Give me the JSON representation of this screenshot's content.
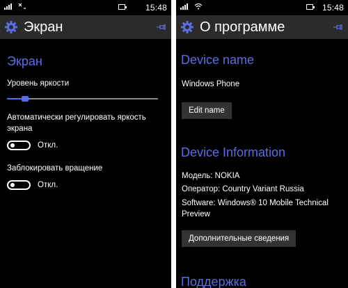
{
  "left_screen": {
    "status": {
      "time": "15:48"
    },
    "title": "Экран",
    "section_title": "Экран",
    "brightness_label": "Уровень яркости",
    "brightness_level": 0.12,
    "auto_brightness_label": "Автоматически регулировать яркость экрана",
    "auto_brightness_state": "Откл.",
    "rotation_lock_label": "Заблокировать вращение",
    "rotation_lock_state": "Откл."
  },
  "right_screen": {
    "status": {
      "time": "15:48"
    },
    "title": "О программе",
    "device_name_section": "Device name",
    "device_name_value": "Windows Phone",
    "edit_name_button": "Edit name",
    "device_info_section": "Device Information",
    "model": "Модель: NOKIA",
    "operator": "Оператор: Country Variant Russia",
    "software": "Software: Windows® 10 Mobile Technical Preview",
    "more_info_button": "Дополнительные сведения",
    "support_section": "Поддержка"
  },
  "colors": {
    "accent": "#5a6ee6",
    "titlebar": "#2b2b2b",
    "background": "#000000",
    "button": "#333333"
  },
  "icons": {
    "settings": "gear-icon",
    "pin": "pin-icon",
    "signal": "signal-icon",
    "wifi": "wifi-icon",
    "battery": "battery-icon"
  }
}
